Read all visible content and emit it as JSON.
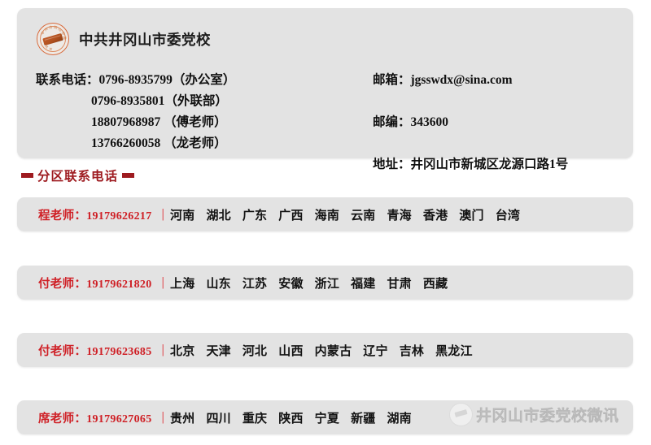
{
  "header": {
    "org_name": "中共井冈山市委党校",
    "seal": {
      "icon": "circular-seal-icon",
      "ring_color": "#d86a3c"
    },
    "contact_left": [
      {
        "label": "联系电话：",
        "value": "0796-8935799（办公室）",
        "indent": false
      },
      {
        "label": "",
        "value": "0796-8935801（外联部）",
        "indent": true
      },
      {
        "label": "",
        "value": "18807968987 （傅老师）",
        "indent": true
      },
      {
        "label": "",
        "value": "13766260058 （龙老师）",
        "indent": true
      }
    ],
    "contact_right": [
      {
        "label": "邮箱：",
        "value": "jgsswdx@sina.com"
      },
      {
        "label": "邮编：",
        "value": "343600"
      },
      {
        "label": "地址：",
        "value": "井冈山市新城区龙源口路1号"
      }
    ]
  },
  "section": {
    "title": "分区联系电话",
    "accent_color": "#9e1b20",
    "dash_icon": "rectangle-dash-icon"
  },
  "rows": [
    {
      "teacher": "程老师：",
      "phone": "19179626217",
      "separator": "|",
      "regions": [
        "河南",
        "湖北",
        "广东",
        "广西",
        "海南",
        "云南",
        "青海",
        "香港",
        "澳门",
        "台湾"
      ]
    },
    {
      "teacher": "付老师：",
      "phone": "19179621820",
      "separator": "|",
      "regions": [
        "上海",
        "山东",
        "江苏",
        "安徽",
        "浙江",
        "福建",
        "甘肃",
        "西藏"
      ]
    },
    {
      "teacher": "付老师：",
      "phone": "19179623685",
      "separator": "|",
      "regions": [
        "北京",
        "天津",
        "河北",
        "山西",
        "内蒙古",
        "辽宁",
        "吉林",
        "黑龙江"
      ]
    },
    {
      "teacher": "席老师：",
      "phone": "19179627065",
      "separator": "|",
      "regions": [
        "贵州",
        "四川",
        "重庆",
        "陕西",
        "宁夏",
        "新疆",
        "湖南"
      ]
    }
  ],
  "watermark": {
    "text": "井冈山市委党校微讯",
    "logo_icon": "round-avatar-icon"
  },
  "colors": {
    "card_background": "#e3e3e3",
    "page_background": "#ffffff",
    "red_accent": "#cf2026",
    "dark_red": "#9e1b20"
  }
}
